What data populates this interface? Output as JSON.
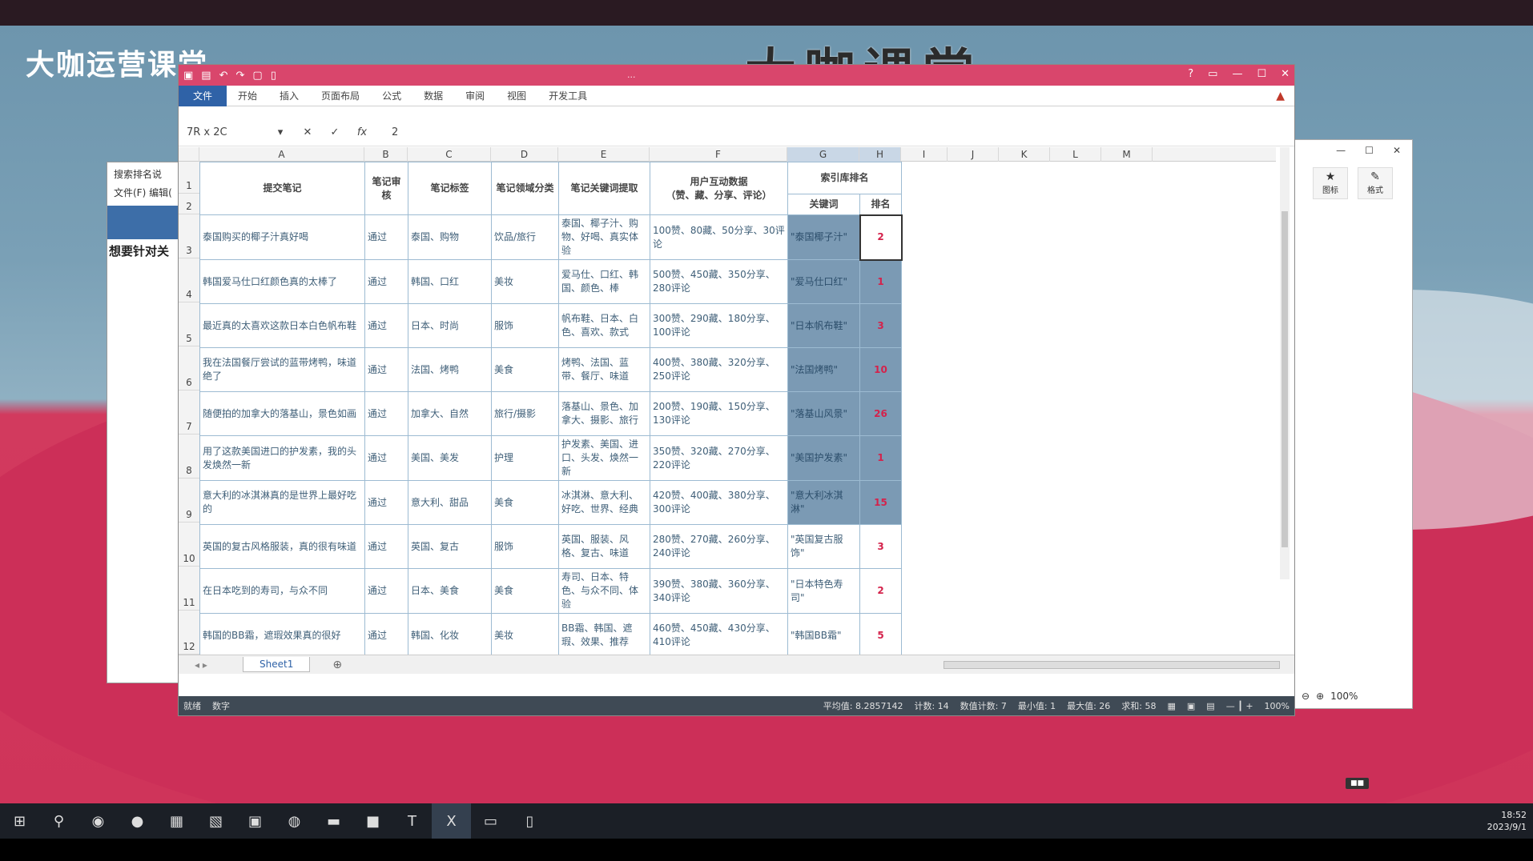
{
  "brand": "大咖运营课堂",
  "watermark": "大咖课堂",
  "bg_window": {
    "title": "搜索排名说",
    "menu": [
      "文件(F)",
      "编辑("
    ],
    "text": "想要针对关"
  },
  "right_panel": {
    "controls": [
      "—",
      "☐",
      "✕"
    ],
    "tools": [
      {
        "glyph": "★",
        "label": "图标"
      },
      {
        "glyph": "✎",
        "label": "格式"
      }
    ],
    "zoom": "100%"
  },
  "excel": {
    "title_text": "...",
    "ribbon_tabs": [
      "开始",
      "插入",
      "页面布局",
      "公式",
      "数据",
      "审阅",
      "视图",
      "开发工具"
    ],
    "file_tab": "文件",
    "name_box": "7R x 2C",
    "formula_value": "2",
    "columns": [
      "A",
      "B",
      "C",
      "D",
      "E",
      "F",
      "G",
      "H",
      "I",
      "J",
      "K",
      "L",
      "M"
    ],
    "headers": {
      "submit": "提交笔记",
      "review": "笔记审核",
      "tag": "笔记标签",
      "category": "笔记领域分类",
      "keywords": "笔记关键词提取",
      "interaction": "用户互动数据\n（赞、藏、分享、评论）",
      "index_rank": "索引库排名",
      "keyword": "关键词",
      "rank": "排名"
    },
    "rows": [
      {
        "note": "泰国购买的椰子汁真好喝",
        "review": "通过",
        "tag": "泰国、购物",
        "cat": "饮品/旅行",
        "kw": "泰国、椰子汁、购物、好喝、真实体验",
        "data": "100赞、80藏、50分享、30评论",
        "keyword": "\"泰国椰子汁\"",
        "rank": "2"
      },
      {
        "note": "韩国爱马仕口红颜色真的太棒了",
        "review": "通过",
        "tag": "韩国、口红",
        "cat": "美妆",
        "kw": "爱马仕、口红、韩国、颜色、棒",
        "data": "500赞、450藏、350分享、280评论",
        "keyword": "\"爱马仕口红\"",
        "rank": "1"
      },
      {
        "note": "最近真的太喜欢这款日本白色帆布鞋",
        "review": "通过",
        "tag": "日本、时尚",
        "cat": "服饰",
        "kw": "帆布鞋、日本、白色、喜欢、款式",
        "data": "300赞、290藏、180分享、100评论",
        "keyword": "\"日本帆布鞋\"",
        "rank": "3"
      },
      {
        "note": "我在法国餐厅尝试的蓝带烤鸭，味道绝了",
        "review": "通过",
        "tag": "法国、烤鸭",
        "cat": "美食",
        "kw": "烤鸭、法国、蓝带、餐厅、味道",
        "data": "400赞、380藏、320分享、250评论",
        "keyword": "\"法国烤鸭\"",
        "rank": "10"
      },
      {
        "note": "随便拍的加拿大的落基山，景色如画",
        "review": "通过",
        "tag": "加拿大、自然",
        "cat": "旅行/摄影",
        "kw": "落基山、景色、加拿大、摄影、旅行",
        "data": "200赞、190藏、150分享、130评论",
        "keyword": "\"落基山风景\"",
        "rank": "26"
      },
      {
        "note": "用了这款美国进口的护发素，我的头发焕然一新",
        "review": "通过",
        "tag": "美国、美发",
        "cat": "护理",
        "kw": "护发素、美国、进口、头发、焕然一新",
        "data": "350赞、320藏、270分享、220评论",
        "keyword": "\"美国护发素\"",
        "rank": "1"
      },
      {
        "note": "意大利的冰淇淋真的是世界上最好吃的",
        "review": "通过",
        "tag": "意大利、甜品",
        "cat": "美食",
        "kw": "冰淇淋、意大利、好吃、世界、经典",
        "data": "420赞、400藏、380分享、300评论",
        "keyword": "\"意大利冰淇淋\"",
        "rank": "15"
      },
      {
        "note": "英国的复古风格服装，真的很有味道",
        "review": "通过",
        "tag": "英国、复古",
        "cat": "服饰",
        "kw": "英国、服装、风格、复古、味道",
        "data": "280赞、270藏、260分享、240评论",
        "keyword": "\"英国复古服饰\"",
        "rank": "3"
      },
      {
        "note": "在日本吃到的寿司，与众不同",
        "review": "通过",
        "tag": "日本、美食",
        "cat": "美食",
        "kw": "寿司、日本、特色、与众不同、体验",
        "data": "390赞、380藏、360分享、340评论",
        "keyword": "\"日本特色寿司\"",
        "rank": "2"
      },
      {
        "note": "韩国的BB霜，遮瑕效果真的很好",
        "review": "通过",
        "tag": "韩国、化妆",
        "cat": "美妆",
        "kw": "BB霜、韩国、遮瑕、效果、推荐",
        "data": "460赞、450藏、430分享、410评论",
        "keyword": "\"韩国BB霜\"",
        "rank": "5"
      }
    ],
    "sheet_tab": "Sheet1",
    "status": {
      "ready": "就绪",
      "num": "数字",
      "avg": "平均值: 8.2857142",
      "count": "计数: 14",
      "numcount": "数值计数: 7",
      "min": "最小值: 1",
      "max": "最大值: 26",
      "sum": "求和: 58",
      "zoom": "100%"
    }
  },
  "clock": {
    "time": "18:52",
    "date": "2023/9/1"
  }
}
